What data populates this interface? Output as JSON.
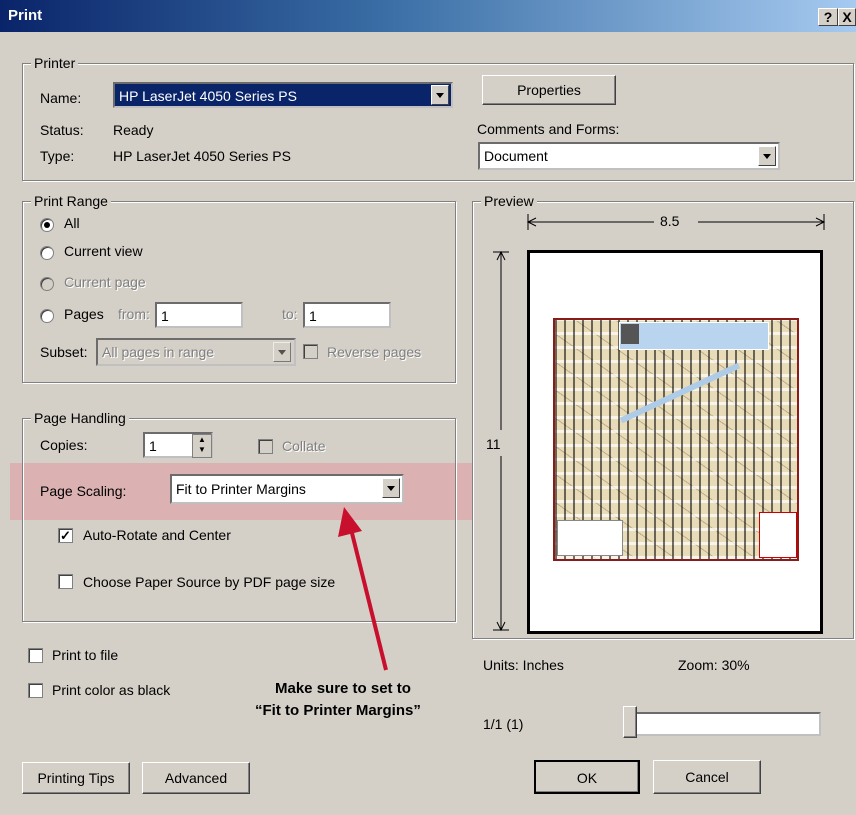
{
  "window": {
    "title": "Print",
    "help_label": "?",
    "close_label": "X"
  },
  "printer": {
    "legend": "Printer",
    "name_label": "Name:",
    "name_value": "HP LaserJet 4050 Series PS",
    "status_label": "Status:",
    "status_value": "Ready",
    "type_label": "Type:",
    "type_value": "HP LaserJet 4050 Series PS",
    "properties_label": "Properties",
    "comments_label": "Comments and Forms:",
    "comments_value": "Document"
  },
  "print_range": {
    "legend": "Print Range",
    "all": "All",
    "current_view": "Current view",
    "current_page": "Current page",
    "pages": "Pages",
    "from_label": "from:",
    "from_value": "1",
    "to_label": "to:",
    "to_value": "1",
    "subset_label": "Subset:",
    "subset_value": "All pages in range",
    "reverse_label": "Reverse pages"
  },
  "page_handling": {
    "legend": "Page Handling",
    "copies_label": "Copies:",
    "copies_value": "1",
    "collate_label": "Collate",
    "scaling_label": "Page Scaling:",
    "scaling_value": "Fit to Printer Margins",
    "auto_rotate_label": "Auto-Rotate and Center",
    "paper_source_label": "Choose Paper Source by PDF page size"
  },
  "options": {
    "print_to_file": "Print to file",
    "color_as_black": "Print color as black"
  },
  "annotation": {
    "line1": "Make sure to set to",
    "line2": "“Fit to Printer Margins”"
  },
  "preview": {
    "legend": "Preview",
    "width_label": "8.5",
    "height_label": "11",
    "units_label": "Units: Inches",
    "zoom_label": "Zoom:  30%",
    "page_label": "1/1 (1)"
  },
  "buttons": {
    "tips": "Printing Tips",
    "advanced": "Advanced",
    "ok": "OK",
    "cancel": "Cancel"
  },
  "colors": {
    "title_start": "#0a246a",
    "highlight": "#e68c96",
    "arrow": "#c8102e",
    "dialog_bg": "#d4d0c8"
  }
}
